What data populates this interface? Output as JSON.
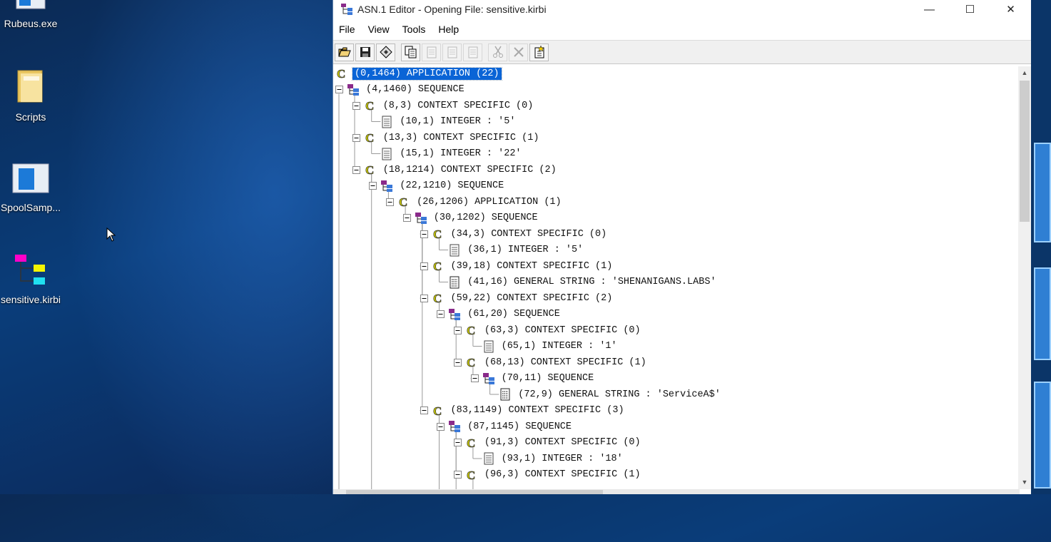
{
  "desktop": {
    "icons": [
      {
        "label": "Rubeus.exe",
        "icon": "application-icon"
      },
      {
        "label": "Scripts",
        "icon": "folder-icon"
      },
      {
        "label": "SpoolSamp...",
        "icon": "application-icon"
      },
      {
        "label": "sensitive.kirbi",
        "icon": "asn1-file-icon"
      }
    ]
  },
  "window": {
    "title": "ASN.1 Editor - Opening File: sensitive.kirbi",
    "controls": {
      "minimize": "—",
      "maximize": "☐",
      "close": "✕"
    },
    "menu": [
      "File",
      "View",
      "Tools",
      "Help"
    ],
    "toolbar": [
      "open-icon",
      "save-icon",
      "save-as-icon",
      "copy-icon",
      "paste-icon",
      "paste-before-icon",
      "paste-after-icon",
      "cut-icon",
      "delete-icon",
      "new-node-icon"
    ]
  },
  "tree": [
    {
      "text": "(0,1464) APPLICATION (22)",
      "icon": "context",
      "depth": 0,
      "selected": true,
      "expander": false
    },
    {
      "text": "(4,1460) SEQUENCE",
      "icon": "sequence",
      "depth": 0,
      "expander": true
    },
    {
      "text": "(8,3) CONTEXT SPECIFIC (0)",
      "icon": "context",
      "depth": 1,
      "expander": true
    },
    {
      "text": "(10,1) INTEGER : '5'",
      "icon": "integer",
      "depth": 2,
      "expander": false
    },
    {
      "text": "(13,3) CONTEXT SPECIFIC (1)",
      "icon": "context",
      "depth": 1,
      "expander": true
    },
    {
      "text": "(15,1) INTEGER : '22'",
      "icon": "integer",
      "depth": 2,
      "expander": false
    },
    {
      "text": "(18,1214) CONTEXT SPECIFIC (2)",
      "icon": "context",
      "depth": 1,
      "expander": true
    },
    {
      "text": "(22,1210) SEQUENCE",
      "icon": "sequence",
      "depth": 2,
      "expander": true
    },
    {
      "text": "(26,1206) APPLICATION (1)",
      "icon": "context",
      "depth": 3,
      "expander": true
    },
    {
      "text": "(30,1202) SEQUENCE",
      "icon": "sequence",
      "depth": 4,
      "expander": true
    },
    {
      "text": "(34,3) CONTEXT SPECIFIC (0)",
      "icon": "context",
      "depth": 5,
      "expander": true
    },
    {
      "text": "(36,1) INTEGER : '5'",
      "icon": "integer",
      "depth": 6,
      "expander": false
    },
    {
      "text": "(39,18) CONTEXT SPECIFIC (1)",
      "icon": "context",
      "depth": 5,
      "expander": true
    },
    {
      "text": "(41,16) GENERAL STRING : 'SHENANIGANS.LABS'",
      "icon": "string",
      "depth": 6,
      "expander": false
    },
    {
      "text": "(59,22) CONTEXT SPECIFIC (2)",
      "icon": "context",
      "depth": 5,
      "expander": true
    },
    {
      "text": "(61,20) SEQUENCE",
      "icon": "sequence",
      "depth": 6,
      "expander": true
    },
    {
      "text": "(63,3) CONTEXT SPECIFIC (0)",
      "icon": "context",
      "depth": 7,
      "expander": true
    },
    {
      "text": "(65,1) INTEGER : '1'",
      "icon": "integer",
      "depth": 8,
      "expander": false
    },
    {
      "text": "(68,13) CONTEXT SPECIFIC (1)",
      "icon": "context",
      "depth": 7,
      "expander": true
    },
    {
      "text": "(70,11) SEQUENCE",
      "icon": "sequence",
      "depth": 8,
      "expander": true
    },
    {
      "text": "(72,9) GENERAL STRING : 'ServiceA$'",
      "icon": "string",
      "depth": 9,
      "expander": false
    },
    {
      "text": "(83,1149) CONTEXT SPECIFIC (3)",
      "icon": "context",
      "depth": 5,
      "expander": true
    },
    {
      "text": "(87,1145) SEQUENCE",
      "icon": "sequence",
      "depth": 6,
      "expander": true
    },
    {
      "text": "(91,3) CONTEXT SPECIFIC (0)",
      "icon": "context",
      "depth": 7,
      "expander": true
    },
    {
      "text": "(93,1) INTEGER : '18'",
      "icon": "integer",
      "depth": 8,
      "expander": false
    },
    {
      "text": "(96,3) CONTEXT SPECIFIC (1)",
      "icon": "context",
      "depth": 7,
      "expander": true
    }
  ],
  "colors": {
    "selection": "#0a64d6",
    "context_icon": "#c8c800",
    "sequence_purple": "#8a2a8a",
    "sequence_blue": "#3a78d8"
  }
}
